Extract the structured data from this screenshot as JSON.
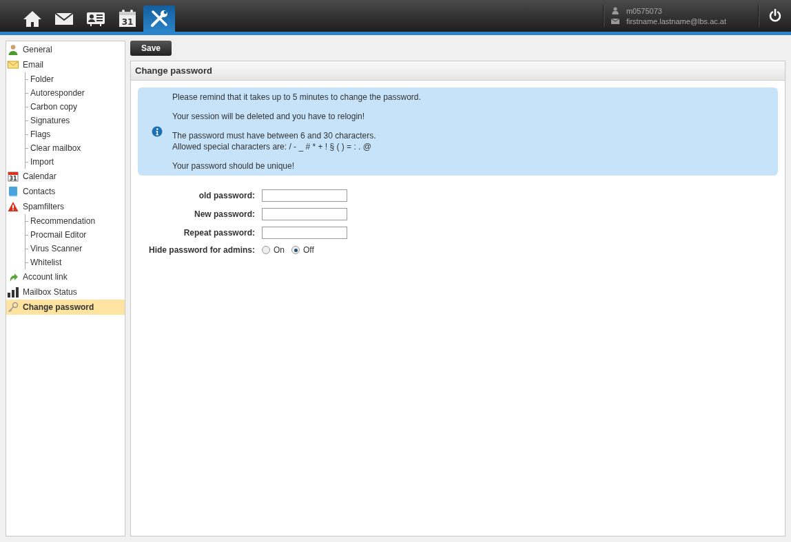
{
  "top_nav": [
    {
      "kind": "home",
      "selected": false
    },
    {
      "kind": "mail",
      "selected": false
    },
    {
      "kind": "contacts",
      "selected": false
    },
    {
      "kind": "calendar",
      "selected": false,
      "label": "31"
    },
    {
      "kind": "tools",
      "selected": true
    }
  ],
  "user": {
    "login": "m0575073",
    "email": "firstname.lastname@lbs.ac.at"
  },
  "sidebar": {
    "items": [
      {
        "label": "General",
        "kind": "person",
        "selected": false
      },
      {
        "label": "Email",
        "kind": "mail",
        "selected": false,
        "children": [
          {
            "label": "Folder"
          },
          {
            "label": "Autoresponder"
          },
          {
            "label": "Carbon copy"
          },
          {
            "label": "Signatures"
          },
          {
            "label": "Flags"
          },
          {
            "label": "Clear mailbox"
          },
          {
            "label": "Import"
          }
        ]
      },
      {
        "label": "Calendar",
        "kind": "calendar",
        "selected": false,
        "icon_text": "31"
      },
      {
        "label": "Contacts",
        "kind": "book",
        "selected": false
      },
      {
        "label": "Spamfilters",
        "kind": "warning",
        "selected": false,
        "children": [
          {
            "label": "Recommendation"
          },
          {
            "label": "Procmail Editor"
          },
          {
            "label": "Virus Scanner"
          },
          {
            "label": "Whitelist"
          }
        ]
      },
      {
        "label": "Account link",
        "kind": "arrow",
        "selected": false
      },
      {
        "label": "Mailbox Status",
        "kind": "bars",
        "selected": false
      },
      {
        "label": "Change password",
        "kind": "key",
        "selected": true
      }
    ]
  },
  "toolbar": {
    "save_button": "Save"
  },
  "panel": {
    "title": "Change password",
    "info": {
      "paragraphs": [
        [
          "Please remind that it takes up to 5 minutes to change the password."
        ],
        [
          "Your session will be deleted and you have to relogin!"
        ],
        [
          "The password must have between 6 and 30 characters.",
          "Allowed special characters are: / - _ # * + ! § ( ) = : . @"
        ],
        [
          "Your password should be unique!"
        ]
      ]
    },
    "fields": [
      {
        "label": "old password:"
      },
      {
        "label": "New password:"
      },
      {
        "label": "Repeat password:"
      }
    ],
    "hide_option": {
      "label": "Hide password for admins:",
      "options": [
        {
          "label": "On",
          "selected": false
        },
        {
          "label": "Off",
          "selected": true
        }
      ]
    }
  }
}
